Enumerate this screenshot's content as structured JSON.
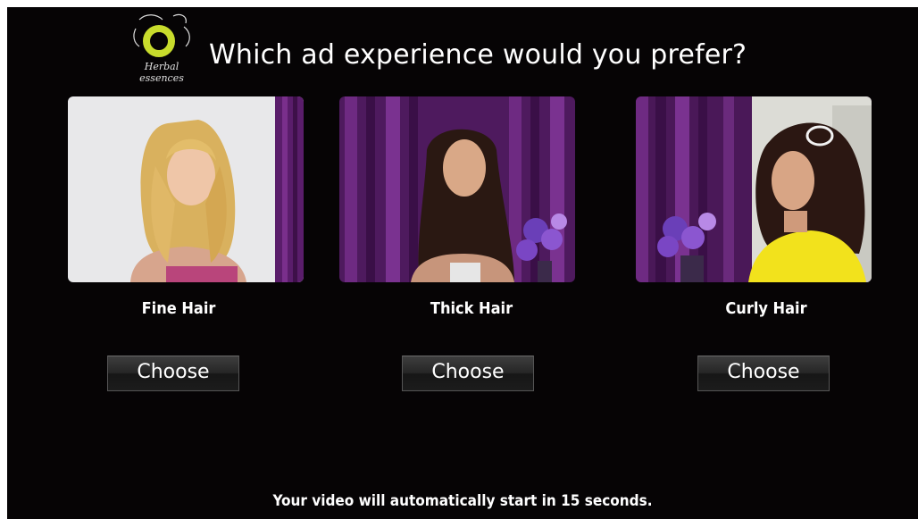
{
  "brand": {
    "logo_text_line1": "Herbal",
    "logo_text_line2": "essences",
    "logo_icon": "herbal-essences-logo",
    "accent_color": "#c8dc2c"
  },
  "header": {
    "title": "Which ad experience would you prefer?"
  },
  "options": [
    {
      "label": "Fine Hair",
      "button_label": "Choose",
      "image": "blonde-woman-fine-hair"
    },
    {
      "label": "Thick Hair",
      "button_label": "Choose",
      "image": "brunette-woman-thick-hair"
    },
    {
      "label": "Curly Hair",
      "button_label": "Choose",
      "image": "curly-hair-woman-yellow-top"
    }
  ],
  "footer": {
    "countdown_text": "Your video will automatically start in 15 seconds."
  },
  "colors": {
    "background": "#060405",
    "curtain": "#5a1d6b",
    "text": "#ffffff"
  }
}
